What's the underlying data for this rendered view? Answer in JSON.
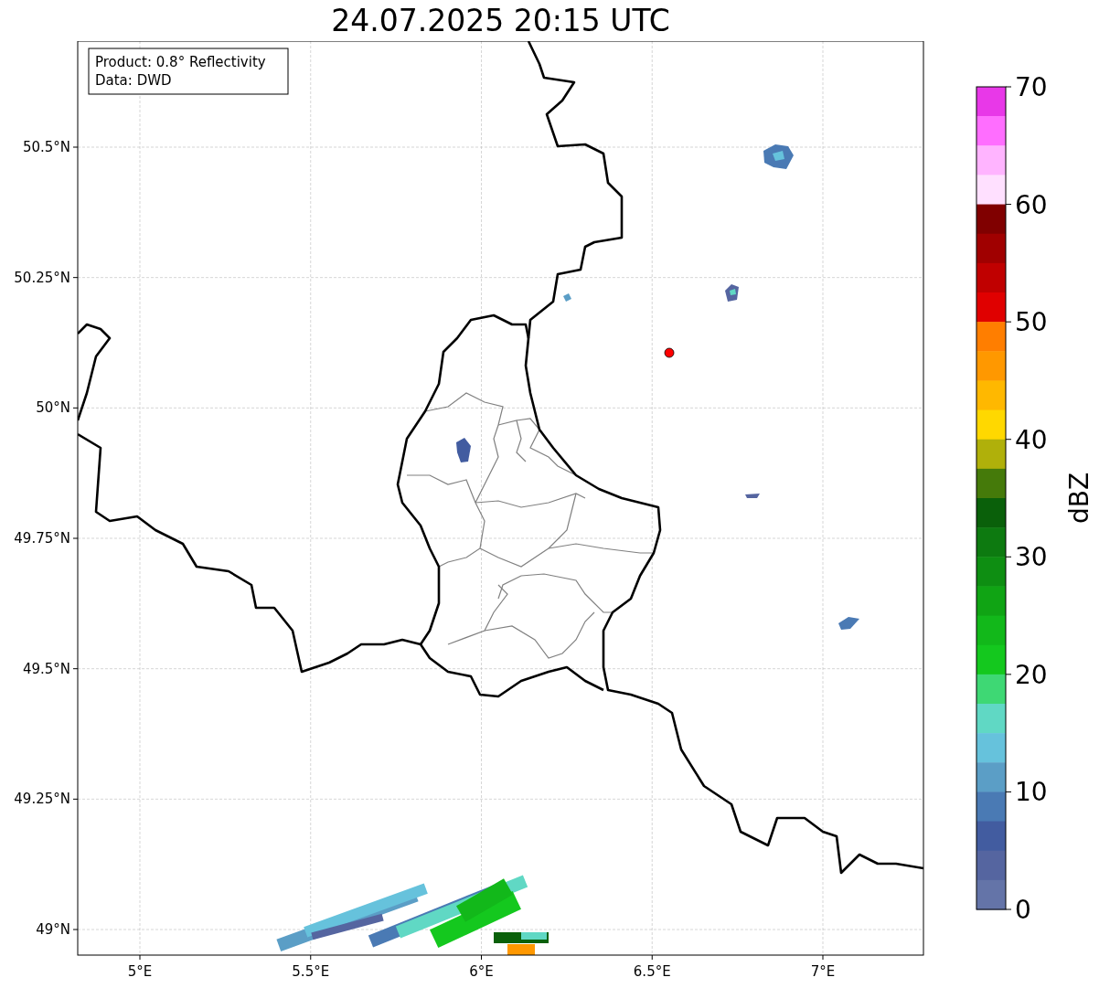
{
  "title": "24.07.2025 20:15 UTC",
  "legend": [
    "Product: 0.8° Reflectivity",
    "Data: DWD"
  ],
  "x_ticks": [
    "5°E",
    "5.5°E",
    "6°E",
    "6.5°E",
    "7°E"
  ],
  "y_ticks": [
    "50.5°N",
    "50.25°N",
    "50°N",
    "49.75°N",
    "49.5°N",
    "49.25°N",
    "49°N"
  ],
  "colorbar": {
    "label": "dBZ",
    "ticks": [
      "70",
      "60",
      "50",
      "40",
      "30",
      "20",
      "10",
      "0"
    ],
    "bands": [
      {
        "color": "#e838e8"
      },
      {
        "color": "#ff6eff"
      },
      {
        "color": "#ffb4ff"
      },
      {
        "color": "#ffe0ff"
      },
      {
        "color": "#800000"
      },
      {
        "color": "#a00000"
      },
      {
        "color": "#c00000"
      },
      {
        "color": "#e00000"
      },
      {
        "color": "#ff7e00"
      },
      {
        "color": "#ff9800"
      },
      {
        "color": "#ffb800"
      },
      {
        "color": "#ffd800"
      },
      {
        "color": "#b0b00a"
      },
      {
        "color": "#457a0a"
      },
      {
        "color": "#0a600a"
      },
      {
        "color": "#0d7a10"
      },
      {
        "color": "#0e8e12"
      },
      {
        "color": "#10a414"
      },
      {
        "color": "#12b81a"
      },
      {
        "color": "#14c81e"
      },
      {
        "color": "#3ed874"
      },
      {
        "color": "#60d8c4"
      },
      {
        "color": "#66c2dc"
      },
      {
        "color": "#5b9ec6"
      },
      {
        "color": "#4a7ab4"
      },
      {
        "color": "#425ca0"
      },
      {
        "color": "#5565a0"
      },
      {
        "color": "#6474a8"
      }
    ]
  }
}
